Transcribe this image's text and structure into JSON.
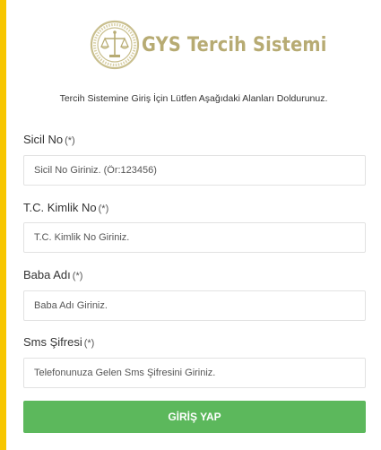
{
  "brand": {
    "title": "GYS Tercih Sistemi",
    "accent_color": "#f7c600",
    "logo_color": "#b7ab73",
    "seal_icon": "justice-scales-seal-icon"
  },
  "form": {
    "instruction": "Tercih Sistemine Giriş İçin Lütfen Aşağıdaki Alanları Doldurunuz.",
    "required_mark": "(*)",
    "fields": [
      {
        "label": "Sicil No",
        "placeholder": "Sicil No Giriniz. (Ör:123456)",
        "value": ""
      },
      {
        "label": "T.C. Kimlik No",
        "placeholder": "T.C. Kimlik No Giriniz.",
        "value": ""
      },
      {
        "label": "Baba Adı",
        "placeholder": "Baba Adı Giriniz.",
        "value": ""
      },
      {
        "label": "Sms Şifresi",
        "placeholder": "Telefonunuza Gelen Sms Şifresini Giriniz.",
        "value": ""
      }
    ],
    "submit_label": "GİRİŞ YAP",
    "submit_color": "#5cb85c"
  }
}
